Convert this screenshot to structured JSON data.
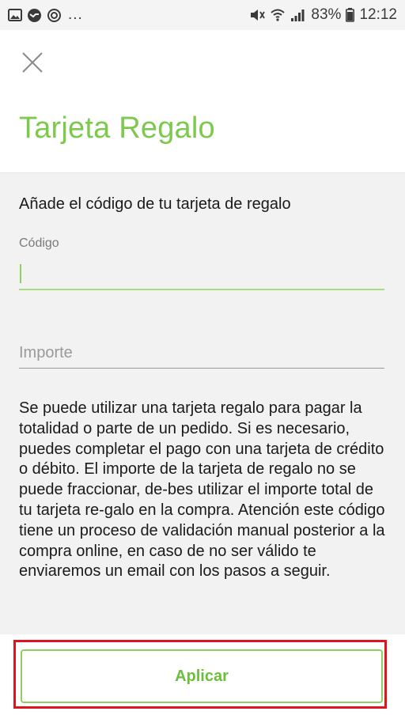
{
  "status_bar": {
    "battery": "83%",
    "time": "12:12",
    "overflow": "...",
    "icons": [
      "gallery-icon",
      "messenger-icon",
      "sync-icon",
      "mute-icon",
      "wifi-icon",
      "signal-icon",
      "battery-icon"
    ]
  },
  "header": {
    "title": "Tarjeta Regalo",
    "close_icon": "close-icon"
  },
  "form": {
    "heading": "Añade el código de tu tarjeta de regalo",
    "code_label": "Código",
    "code_value": "",
    "amount_placeholder": "Importe",
    "info": "Se puede utilizar una tarjeta regalo para pagar la totalidad o parte de un pedido. Si es necesario, puedes completar el pago con una tarjeta de crédito o débito. El importe de la tarjeta de regalo no se puede fraccionar, de-bes utilizar el importe total de tu tarjeta re-galo en la compra. Atención este código tiene un proceso de validación manual posterior a la compra online, en caso de no ser válido te enviaremos un email con los pasos a seguir."
  },
  "footer": {
    "apply_label": "Aplicar"
  },
  "colors": {
    "accent": "#7cc94d",
    "highlight": "#e0141e"
  }
}
